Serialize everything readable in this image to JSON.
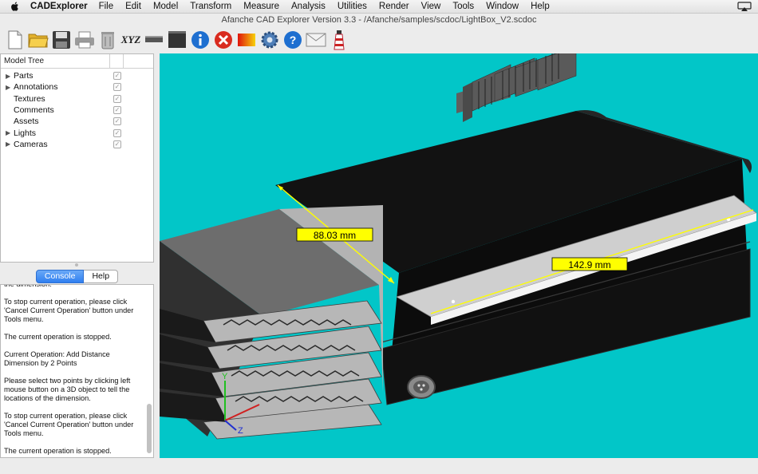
{
  "menubar": {
    "app_name": "CADExplorer",
    "items": [
      "File",
      "Edit",
      "Model",
      "Transform",
      "Measure",
      "Analysis",
      "Utilities",
      "Render",
      "View",
      "Tools",
      "Window",
      "Help"
    ]
  },
  "window": {
    "title": "Afanche CAD Explorer Version 3.3 - /Afanche/samples/scdoc/LightBox_V2.scdoc"
  },
  "toolbar": {
    "buttons": [
      {
        "icon": "new-file-icon"
      },
      {
        "icon": "open-folder-icon"
      },
      {
        "icon": "save-icon"
      },
      {
        "icon": "print-icon"
      },
      {
        "icon": "trash-icon"
      },
      {
        "icon": "xyz-icon",
        "label": "XYZ"
      },
      {
        "icon": "ruler-icon"
      },
      {
        "icon": "film-icon"
      },
      {
        "icon": "info-icon"
      },
      {
        "icon": "stop-icon"
      },
      {
        "icon": "gradient-icon"
      },
      {
        "icon": "gear-icon"
      },
      {
        "icon": "help-icon"
      },
      {
        "icon": "mail-icon"
      },
      {
        "icon": "lighthouse-icon"
      }
    ]
  },
  "model_tree": {
    "header": "Model Tree",
    "items": [
      {
        "label": "Parts",
        "expandable": true,
        "checked": true
      },
      {
        "label": "Annotations",
        "expandable": true,
        "checked": true
      },
      {
        "label": "Textures",
        "expandable": false,
        "checked": true
      },
      {
        "label": "Comments",
        "expandable": false,
        "checked": true
      },
      {
        "label": "Assets",
        "expandable": false,
        "checked": true
      },
      {
        "label": "Lights",
        "expandable": true,
        "checked": true
      },
      {
        "label": "Cameras",
        "expandable": true,
        "checked": true
      }
    ]
  },
  "console_tabs": {
    "console": "Console",
    "help": "Help"
  },
  "console": {
    "text": "the dimension.\n\nTo stop current operation, please click 'Cancel Current Operation' button under Tools menu.\n\nThe current operation is stopped.\n\nCurrent Operation: Add Distance Dimension by 2 Points\n\nPlease select two points by clicking left mouse button on a 3D object to tell the locations of the dimension.\n\nTo stop current operation, please click 'Cancel Current Operation' button under Tools menu.\n\nThe current operation is stopped."
  },
  "viewport": {
    "background_color": "#02c6c8",
    "dimensions": [
      {
        "value": "88.03 mm"
      },
      {
        "value": "142.9 mm"
      }
    ],
    "axis_labels": {
      "y": "Y",
      "z": "Z"
    }
  }
}
